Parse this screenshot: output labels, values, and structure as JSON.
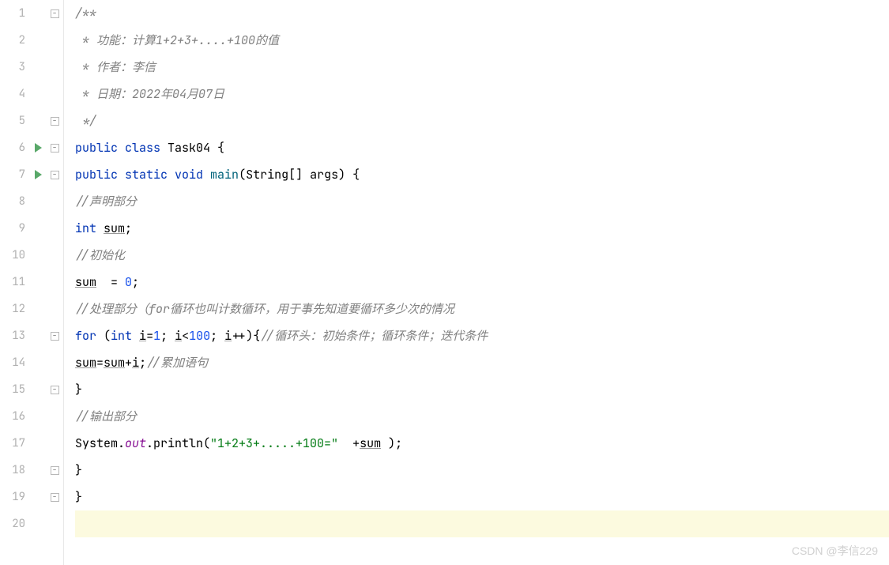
{
  "watermark": "CSDN @李信229",
  "lines": [
    {
      "num": 1,
      "run": false,
      "fold": "open-top"
    },
    {
      "num": 2,
      "run": false,
      "fold": "line"
    },
    {
      "num": 3,
      "run": false,
      "fold": "line"
    },
    {
      "num": 4,
      "run": false,
      "fold": "line"
    },
    {
      "num": 5,
      "run": false,
      "fold": "close"
    },
    {
      "num": 6,
      "run": true,
      "fold": "open"
    },
    {
      "num": 7,
      "run": true,
      "fold": "open"
    },
    {
      "num": 8,
      "run": false,
      "fold": "line"
    },
    {
      "num": 9,
      "run": false,
      "fold": "line"
    },
    {
      "num": 10,
      "run": false,
      "fold": "line"
    },
    {
      "num": 11,
      "run": false,
      "fold": "line"
    },
    {
      "num": 12,
      "run": false,
      "fold": "line"
    },
    {
      "num": 13,
      "run": false,
      "fold": "open"
    },
    {
      "num": 14,
      "run": false,
      "fold": "line"
    },
    {
      "num": 15,
      "run": false,
      "fold": "close"
    },
    {
      "num": 16,
      "run": false,
      "fold": "line"
    },
    {
      "num": 17,
      "run": false,
      "fold": "line"
    },
    {
      "num": 18,
      "run": false,
      "fold": "close"
    },
    {
      "num": 19,
      "run": false,
      "fold": "close"
    },
    {
      "num": 20,
      "run": false,
      "fold": "none"
    }
  ],
  "code": {
    "l1": "/**",
    "l2": " * 功能：计算1+2+3+....+100的值",
    "l3": " * 作者：李信",
    "l4": " * 日期：2022年04月07日",
    "l5": " */",
    "l6_public": "public ",
    "l6_class": "class ",
    "l6_name": "Task04 ",
    "l6_brace": "{",
    "l7_public": "public ",
    "l7_static": "static ",
    "l7_void": "void ",
    "l7_main": "main",
    "l7_paren": "(String[] args) {",
    "l8": "//声明部分",
    "l9_int": "int ",
    "l9_sum": "sum",
    "l9_semi": ";",
    "l10": "//初始化",
    "l11_sum": "sum",
    "l11_eq": "  = ",
    "l11_zero": "0",
    "l11_semi": ";",
    "l12": "//处理部分（for循环也叫计数循环，用于事先知道要循环多少次的情况",
    "l13_for": "for ",
    "l13_p1": "(",
    "l13_int": "int ",
    "l13_i1": "i",
    "l13_eq1": "=",
    "l13_n1": "1",
    "l13_s1": "; ",
    "l13_i2": "i",
    "l13_lt": "<",
    "l13_n100": "100",
    "l13_s2": "; ",
    "l13_i3": "i",
    "l13_pp": "++){",
    "l13_cmt": "//循环头：初始条件；循环条件；迭代条件",
    "l14_sum1": "sum",
    "l14_eq": "=",
    "l14_sum2": "sum",
    "l14_plus": "+",
    "l14_i": "i",
    "l14_semi": ";",
    "l14_cmt": "//累加语句",
    "l15": "}",
    "l16": "//输出部分",
    "l17_sys": "System.",
    "l17_out": "out",
    "l17_dot": ".println(",
    "l17_str": "\"1+2+3+.....+100=\"",
    "l17_sp": "  +",
    "l17_sum": "sum",
    "l17_end": " );",
    "l18": "}",
    "l19": "}"
  }
}
